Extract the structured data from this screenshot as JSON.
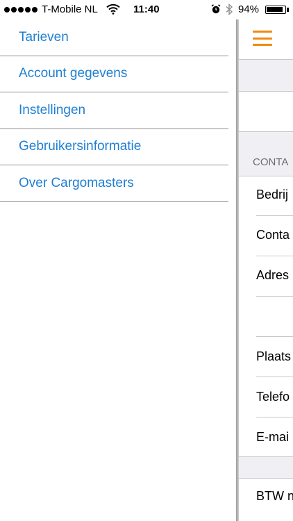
{
  "status_bar": {
    "carrier": "T-Mobile NL",
    "time": "11:40",
    "battery_percent_text": "94%",
    "battery_level": 0.94,
    "icons": [
      "signal-dots-icon",
      "wifi-icon",
      "alarm-icon",
      "bluetooth-icon",
      "battery-icon"
    ]
  },
  "side_menu": {
    "items": [
      {
        "label": "Tarieven"
      },
      {
        "label": "Account gegevens"
      },
      {
        "label": "Instellingen"
      },
      {
        "label": "Gebruikersinformatie"
      },
      {
        "label": "Over Cargomasters"
      }
    ]
  },
  "content": {
    "menu_icon": "hamburger-icon",
    "accent_color": "#f08a10",
    "section_header": "CONTA",
    "rows": [
      "Bedrij",
      "Conta",
      "Adres",
      "Plaats",
      "Telefo",
      "E-mai",
      "BTW n"
    ]
  },
  "colors": {
    "link": "#1e7fd2",
    "accent": "#f08a10",
    "grouped_background": "#efeff4"
  }
}
